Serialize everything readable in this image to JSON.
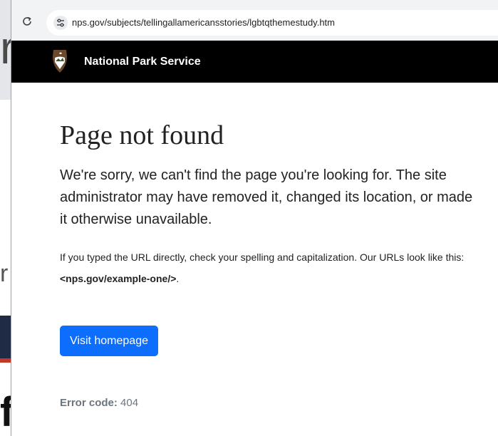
{
  "background": {
    "glyph_top": "r",
    "glyph_mid": "r",
    "glyph_bottom": "f"
  },
  "browser": {
    "url": "nps.gov/subjects/tellingallamericansstories/lgbtqthemestudy.htm",
    "reload_icon": "reload-icon",
    "site_info_icon": "tune-icon"
  },
  "header": {
    "logo_icon": "nps-arrowhead-icon",
    "site_name": "National Park Service"
  },
  "main": {
    "title": "Page not found",
    "lead": "We're sorry, we can't find the page you're looking for. The site administrator may have removed it, changed its location, or made it otherwise unavailable.",
    "help_prefix": "If you typed the URL directly, check your spelling and capitalization. Our URLs look like this: ",
    "help_example": "<nps.gov/example-one/>",
    "help_suffix": ".",
    "button_label": "Visit homepage",
    "error_label": "Error code:",
    "error_value": "404"
  },
  "colors": {
    "header_bg": "#000000",
    "button_bg": "#0d6efd",
    "error_text": "#6c757d"
  }
}
